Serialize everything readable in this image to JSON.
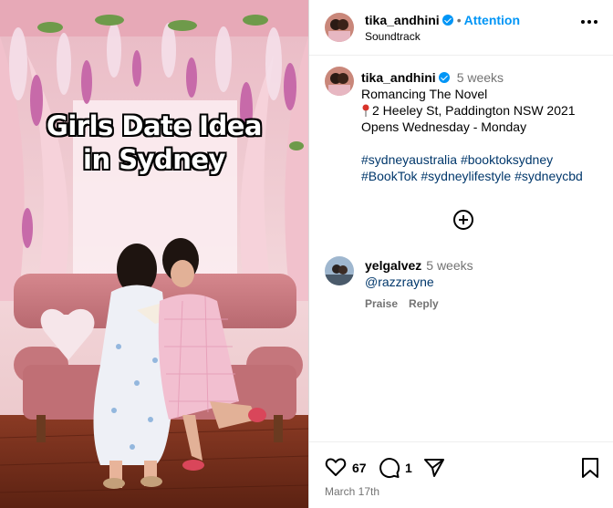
{
  "media": {
    "overlay_line1": "Girls Date Idea",
    "overlay_line2": "in Sydney"
  },
  "header": {
    "username": "tika_andhini",
    "separator": "•",
    "follow_label": "Attention",
    "subtitle": "Soundtrack",
    "more_icon": "more-horizontal-icon"
  },
  "caption": {
    "username": "tika_andhini",
    "time": "5 weeks",
    "line1": "Romancing The Novel",
    "line2": "2 Heeley St, Paddington NSW 2021",
    "line3": "Opens Wednesday - Monday",
    "hashtags_line1": "#sydneyaustralia #booktoksydney",
    "hashtags_line2": "#BookTok #sydneylifestyle #sydneycbd",
    "pin_icon": "round-pushpin-icon"
  },
  "load_more_icon": "plus-circle-icon",
  "comment": {
    "username": "yelgalvez",
    "time": "5 weeks",
    "text": "@razzrayne",
    "praise_label": "Praise",
    "reply_label": "Reply"
  },
  "actions": {
    "like_count": "67",
    "comment_count": "1",
    "date": "March 17th",
    "icons": [
      "heart-icon",
      "comment-icon",
      "share-icon",
      "bookmark-icon"
    ]
  },
  "colors": {
    "accent": "#0095f6",
    "hashtag": "#00376b",
    "muted": "#737373"
  }
}
